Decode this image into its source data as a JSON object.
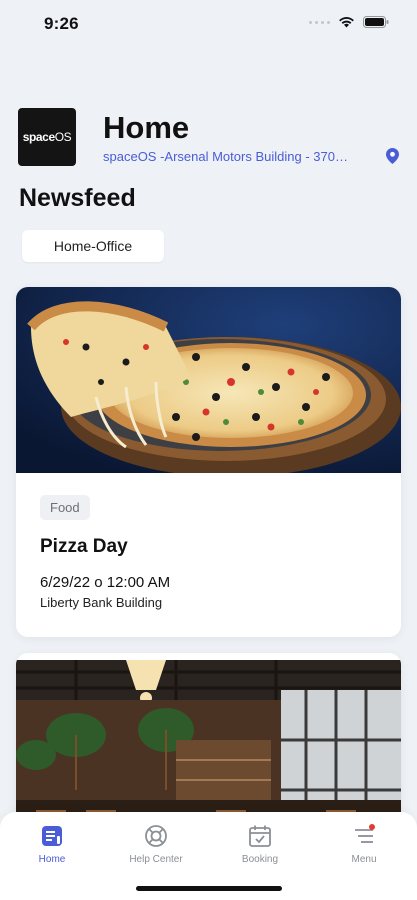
{
  "status_bar": {
    "time": "9:26",
    "icons": [
      "signal-icon",
      "wifi-icon",
      "battery-icon"
    ]
  },
  "header": {
    "logo_text_bold": "space",
    "logo_text_light": "OS",
    "title": "Home",
    "location": "spaceOS -Arsenal Motors Building - 370…",
    "location_icon": "map-pin-icon"
  },
  "newsfeed": {
    "title": "Newsfeed",
    "filter": "Home-Office",
    "cards": [
      {
        "image": "pizza-image",
        "category": "Food",
        "title": "Pizza Day",
        "date": "6/29/22 o 12:00 AM",
        "location": "Liberty Bank Building"
      },
      {
        "image": "restaurant-interior-image"
      }
    ]
  },
  "bottom_nav": {
    "items": [
      {
        "label": "Home",
        "icon": "home-icon",
        "active": true
      },
      {
        "label": "Help Center",
        "icon": "lifebuoy-icon",
        "active": false
      },
      {
        "label": "Booking",
        "icon": "calendar-check-icon",
        "active": false
      },
      {
        "label": "Menu",
        "icon": "menu-icon",
        "active": false,
        "notification_dot": true
      }
    ]
  },
  "colors": {
    "accent": "#4a5dd6",
    "background": "#eef1f6",
    "notification": "#e53935"
  }
}
